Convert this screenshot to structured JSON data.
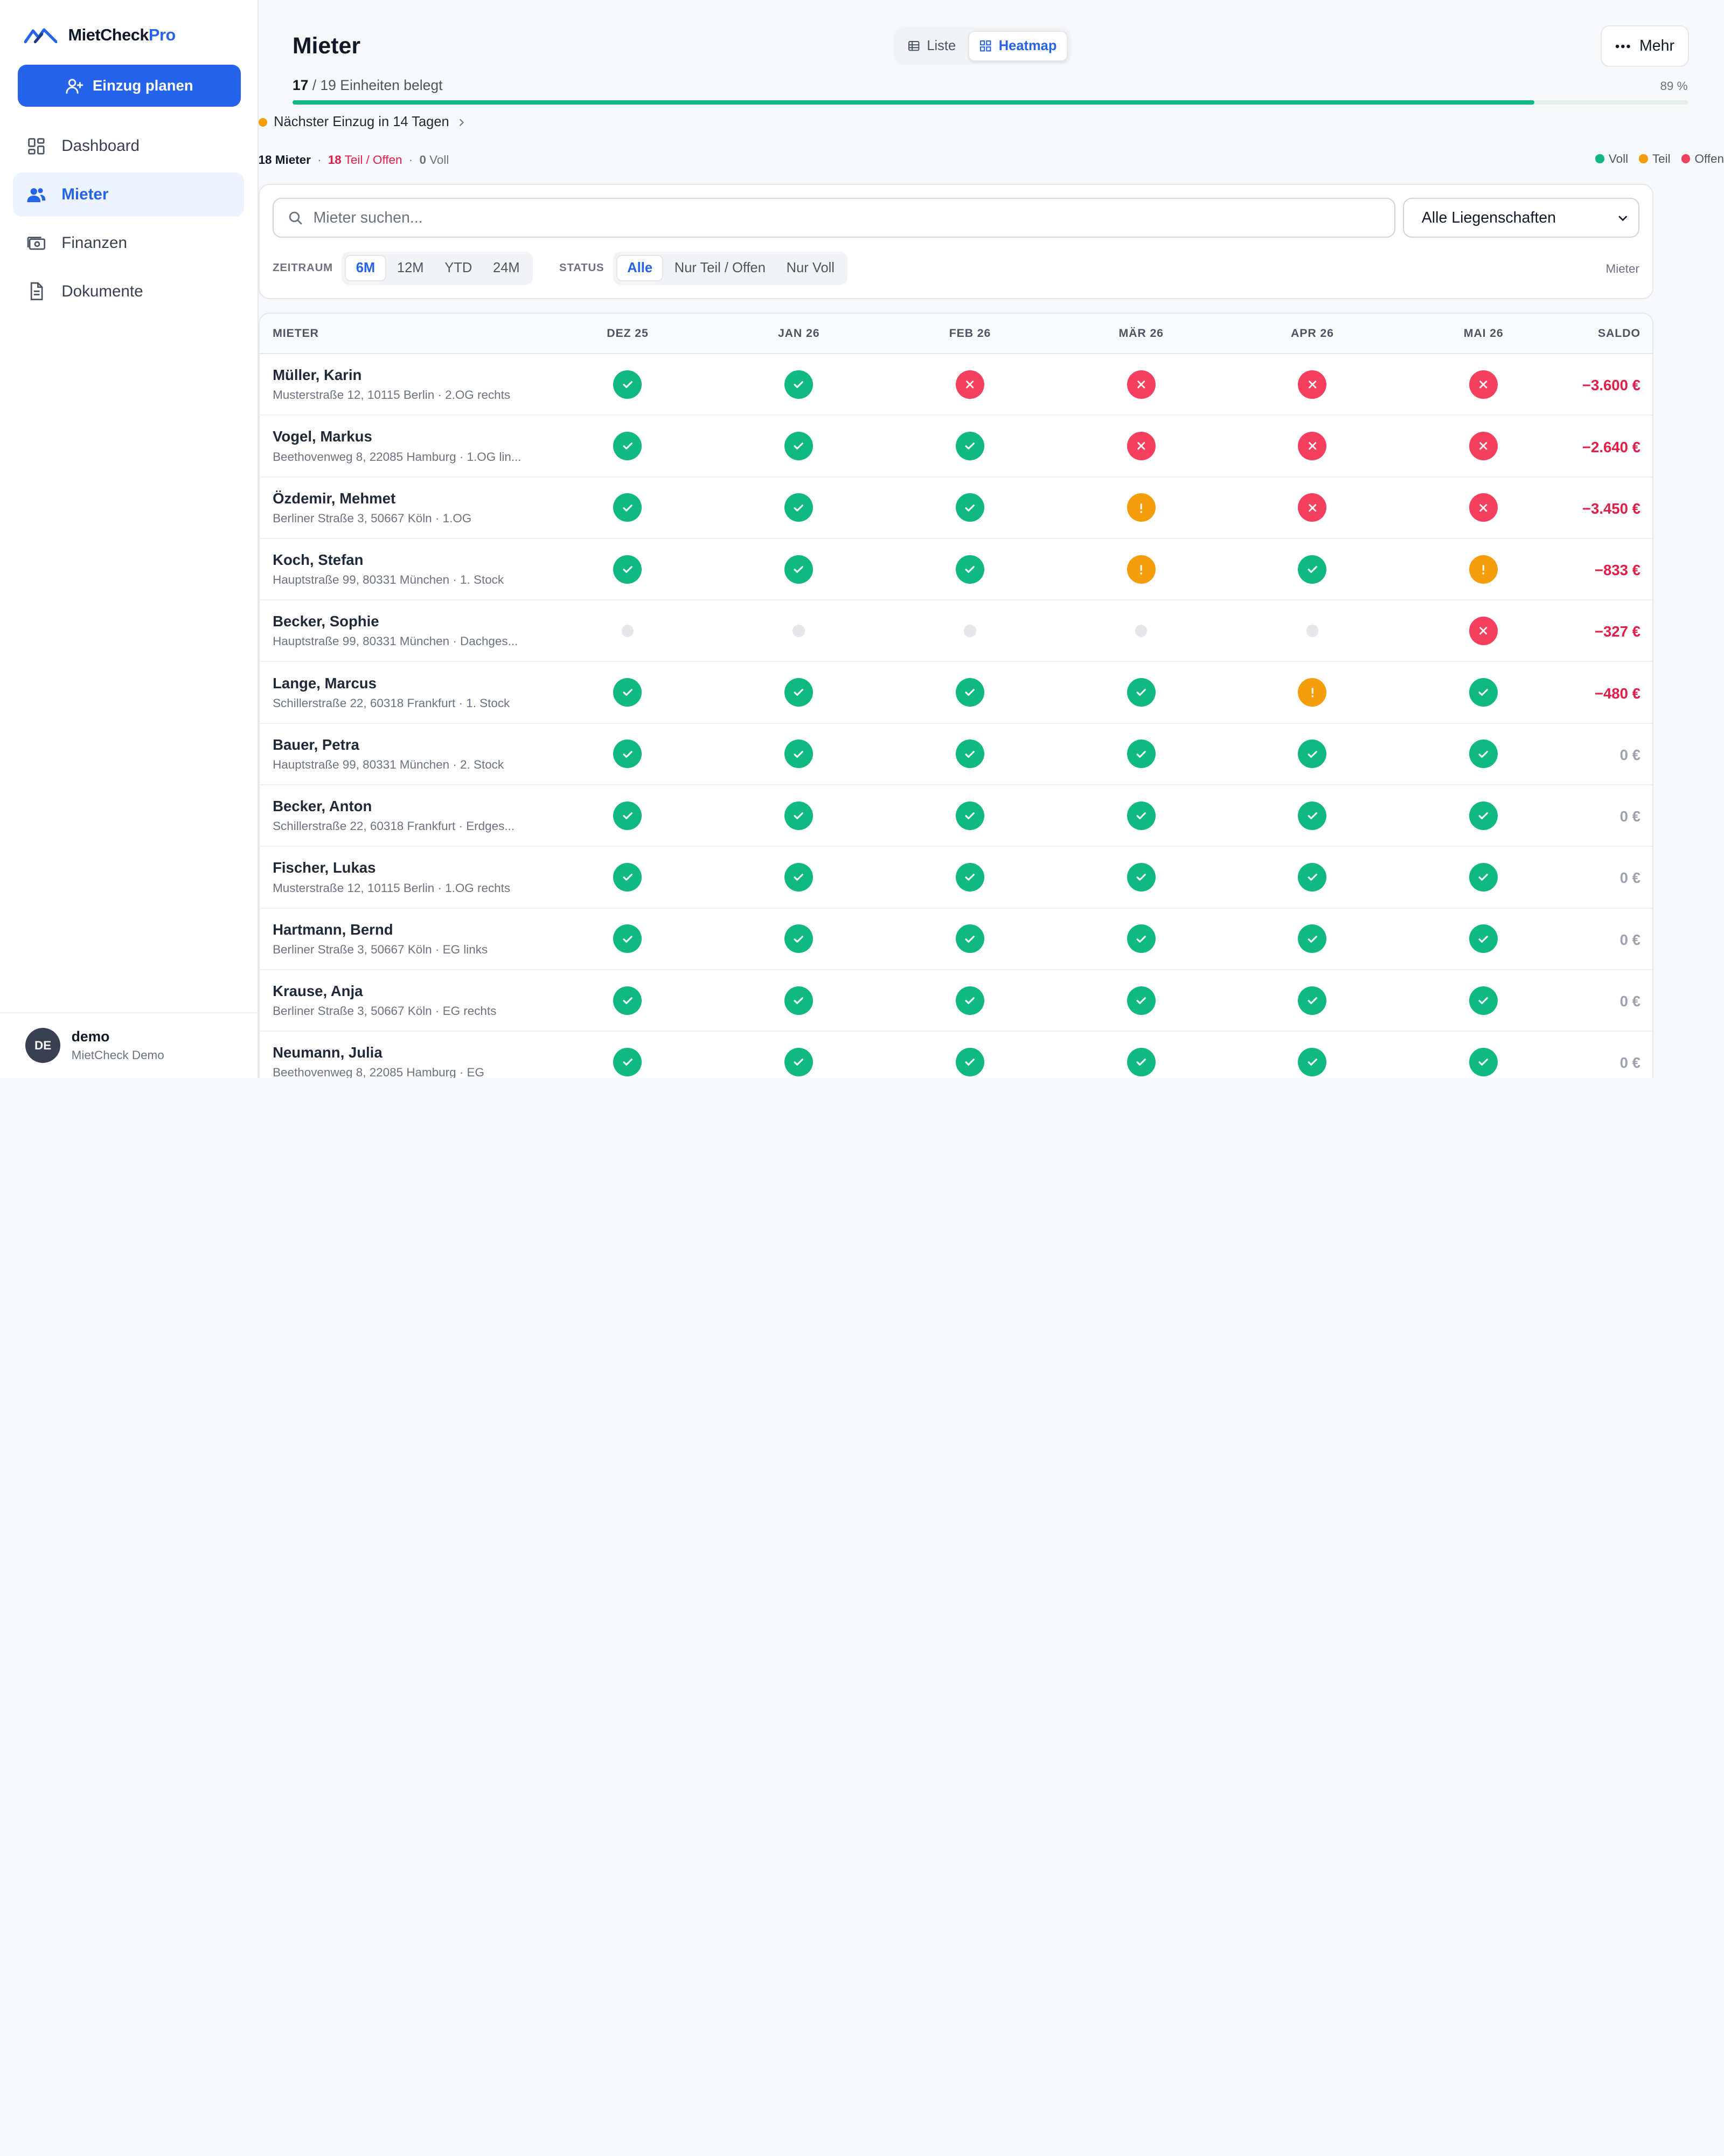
{
  "brand": {
    "name": "MietCheck",
    "suffix": "Pro"
  },
  "sidebar": {
    "cta_label": "Einzug planen",
    "items": [
      {
        "label": "Dashboard",
        "icon": "dashboard-icon"
      },
      {
        "label": "Mieter",
        "icon": "users-icon",
        "active": true
      },
      {
        "label": "Finanzen",
        "icon": "money-icon"
      },
      {
        "label": "Dokumente",
        "icon": "document-icon"
      }
    ],
    "user": {
      "initials": "DE",
      "name": "demo",
      "org": "MietCheck Demo"
    }
  },
  "header": {
    "title": "Mieter",
    "views": [
      "Liste",
      "Heatmap"
    ],
    "active_view": "Heatmap",
    "more_label": "Mehr"
  },
  "occupancy": {
    "occupied": "17",
    "rest": " / 19 Einheiten belegt",
    "percent_label": "89 %",
    "percent": 89
  },
  "next_move": "Nächster Einzug in 14 Tagen",
  "summary": {
    "tenants_num": "18",
    "tenants_label": "Mieter",
    "partial_num": "18",
    "partial_label": "Teil / Offen",
    "full_num": "0",
    "full_label": "Voll"
  },
  "legend": [
    "Voll",
    "Teil",
    "Offen"
  ],
  "colors": {
    "accent": "#2563eb",
    "voll": "#10b981",
    "teil": "#f59e0b",
    "offen": "#f43f5e",
    "negative": "#e11d48"
  },
  "filters": {
    "search_placeholder": "Mieter suchen...",
    "property_select": "Alle Liegenschaften",
    "zeitraum_label": "ZEITRAUM",
    "zeitraum": [
      "6M",
      "12M",
      "YTD",
      "24M"
    ],
    "zeitraum_active": "6M",
    "status_label": "STATUS",
    "status": [
      "Alle",
      "Nur Teil / Offen",
      "Nur Voll"
    ],
    "status_active": "Alle",
    "right_note": "Mieter"
  },
  "table": {
    "columns": [
      "MIETER",
      "DEZ 25",
      "JAN 26",
      "FEB 26",
      "MÄR 26",
      "APR 26",
      "MAI 26",
      "SALDO"
    ],
    "rows": [
      {
        "name": "Müller, Karin",
        "address": "Musterstraße 12, 10115 Berlin · 2.OG rechts",
        "status": [
          "voll",
          "voll",
          "offen",
          "offen",
          "offen",
          "offen"
        ],
        "saldo": "−3.600 €"
      },
      {
        "name": "Vogel, Markus",
        "address": "Beethovenweg 8, 22085 Hamburg · 1.OG lin...",
        "status": [
          "voll",
          "voll",
          "voll",
          "offen",
          "offen",
          "offen"
        ],
        "saldo": "−2.640 €"
      },
      {
        "name": "Özdemir, Mehmet",
        "address": "Berliner Straße 3, 50667 Köln · 1.OG",
        "status": [
          "voll",
          "voll",
          "voll",
          "teil",
          "offen",
          "offen"
        ],
        "saldo": "−3.450 €"
      },
      {
        "name": "Koch, Stefan",
        "address": "Hauptstraße 99, 80331 München · 1. Stock",
        "status": [
          "voll",
          "voll",
          "voll",
          "teil",
          "voll",
          "teil"
        ],
        "saldo": "−833 €"
      },
      {
        "name": "Becker, Sophie",
        "address": "Hauptstraße 99, 80331 München · Dachges...",
        "status": [
          "none",
          "none",
          "none",
          "none",
          "none",
          "offen"
        ],
        "saldo": "−327 €"
      },
      {
        "name": "Lange, Marcus",
        "address": "Schillerstraße 22, 60318 Frankfurt · 1. Stock",
        "status": [
          "voll",
          "voll",
          "voll",
          "voll",
          "teil",
          "voll"
        ],
        "saldo": "−480 €"
      },
      {
        "name": "Bauer, Petra",
        "address": "Hauptstraße 99, 80331 München · 2. Stock",
        "status": [
          "voll",
          "voll",
          "voll",
          "voll",
          "voll",
          "voll"
        ],
        "saldo": "0 €"
      },
      {
        "name": "Becker, Anton",
        "address": "Schillerstraße 22, 60318 Frankfurt · Erdges...",
        "status": [
          "voll",
          "voll",
          "voll",
          "voll",
          "voll",
          "voll"
        ],
        "saldo": "0 €"
      },
      {
        "name": "Fischer, Lukas",
        "address": "Musterstraße 12, 10115 Berlin · 1.OG rechts",
        "status": [
          "voll",
          "voll",
          "voll",
          "voll",
          "voll",
          "voll"
        ],
        "saldo": "0 €"
      },
      {
        "name": "Hartmann, Bernd",
        "address": "Berliner Straße 3, 50667 Köln · EG links",
        "status": [
          "voll",
          "voll",
          "voll",
          "voll",
          "voll",
          "voll"
        ],
        "saldo": "0 €"
      },
      {
        "name": "Krause, Anja",
        "address": "Berliner Straße 3, 50667 Köln · EG rechts",
        "status": [
          "voll",
          "voll",
          "voll",
          "voll",
          "voll",
          "voll"
        ],
        "saldo": "0 €"
      },
      {
        "name": "Neumann, Julia",
        "address": "Beethovenweg 8, 22085 Hamburg · EG",
        "status": [
          "voll",
          "voll",
          "voll",
          "voll",
          "voll",
          "voll"
        ],
        "saldo": "0 €"
      }
    ]
  }
}
